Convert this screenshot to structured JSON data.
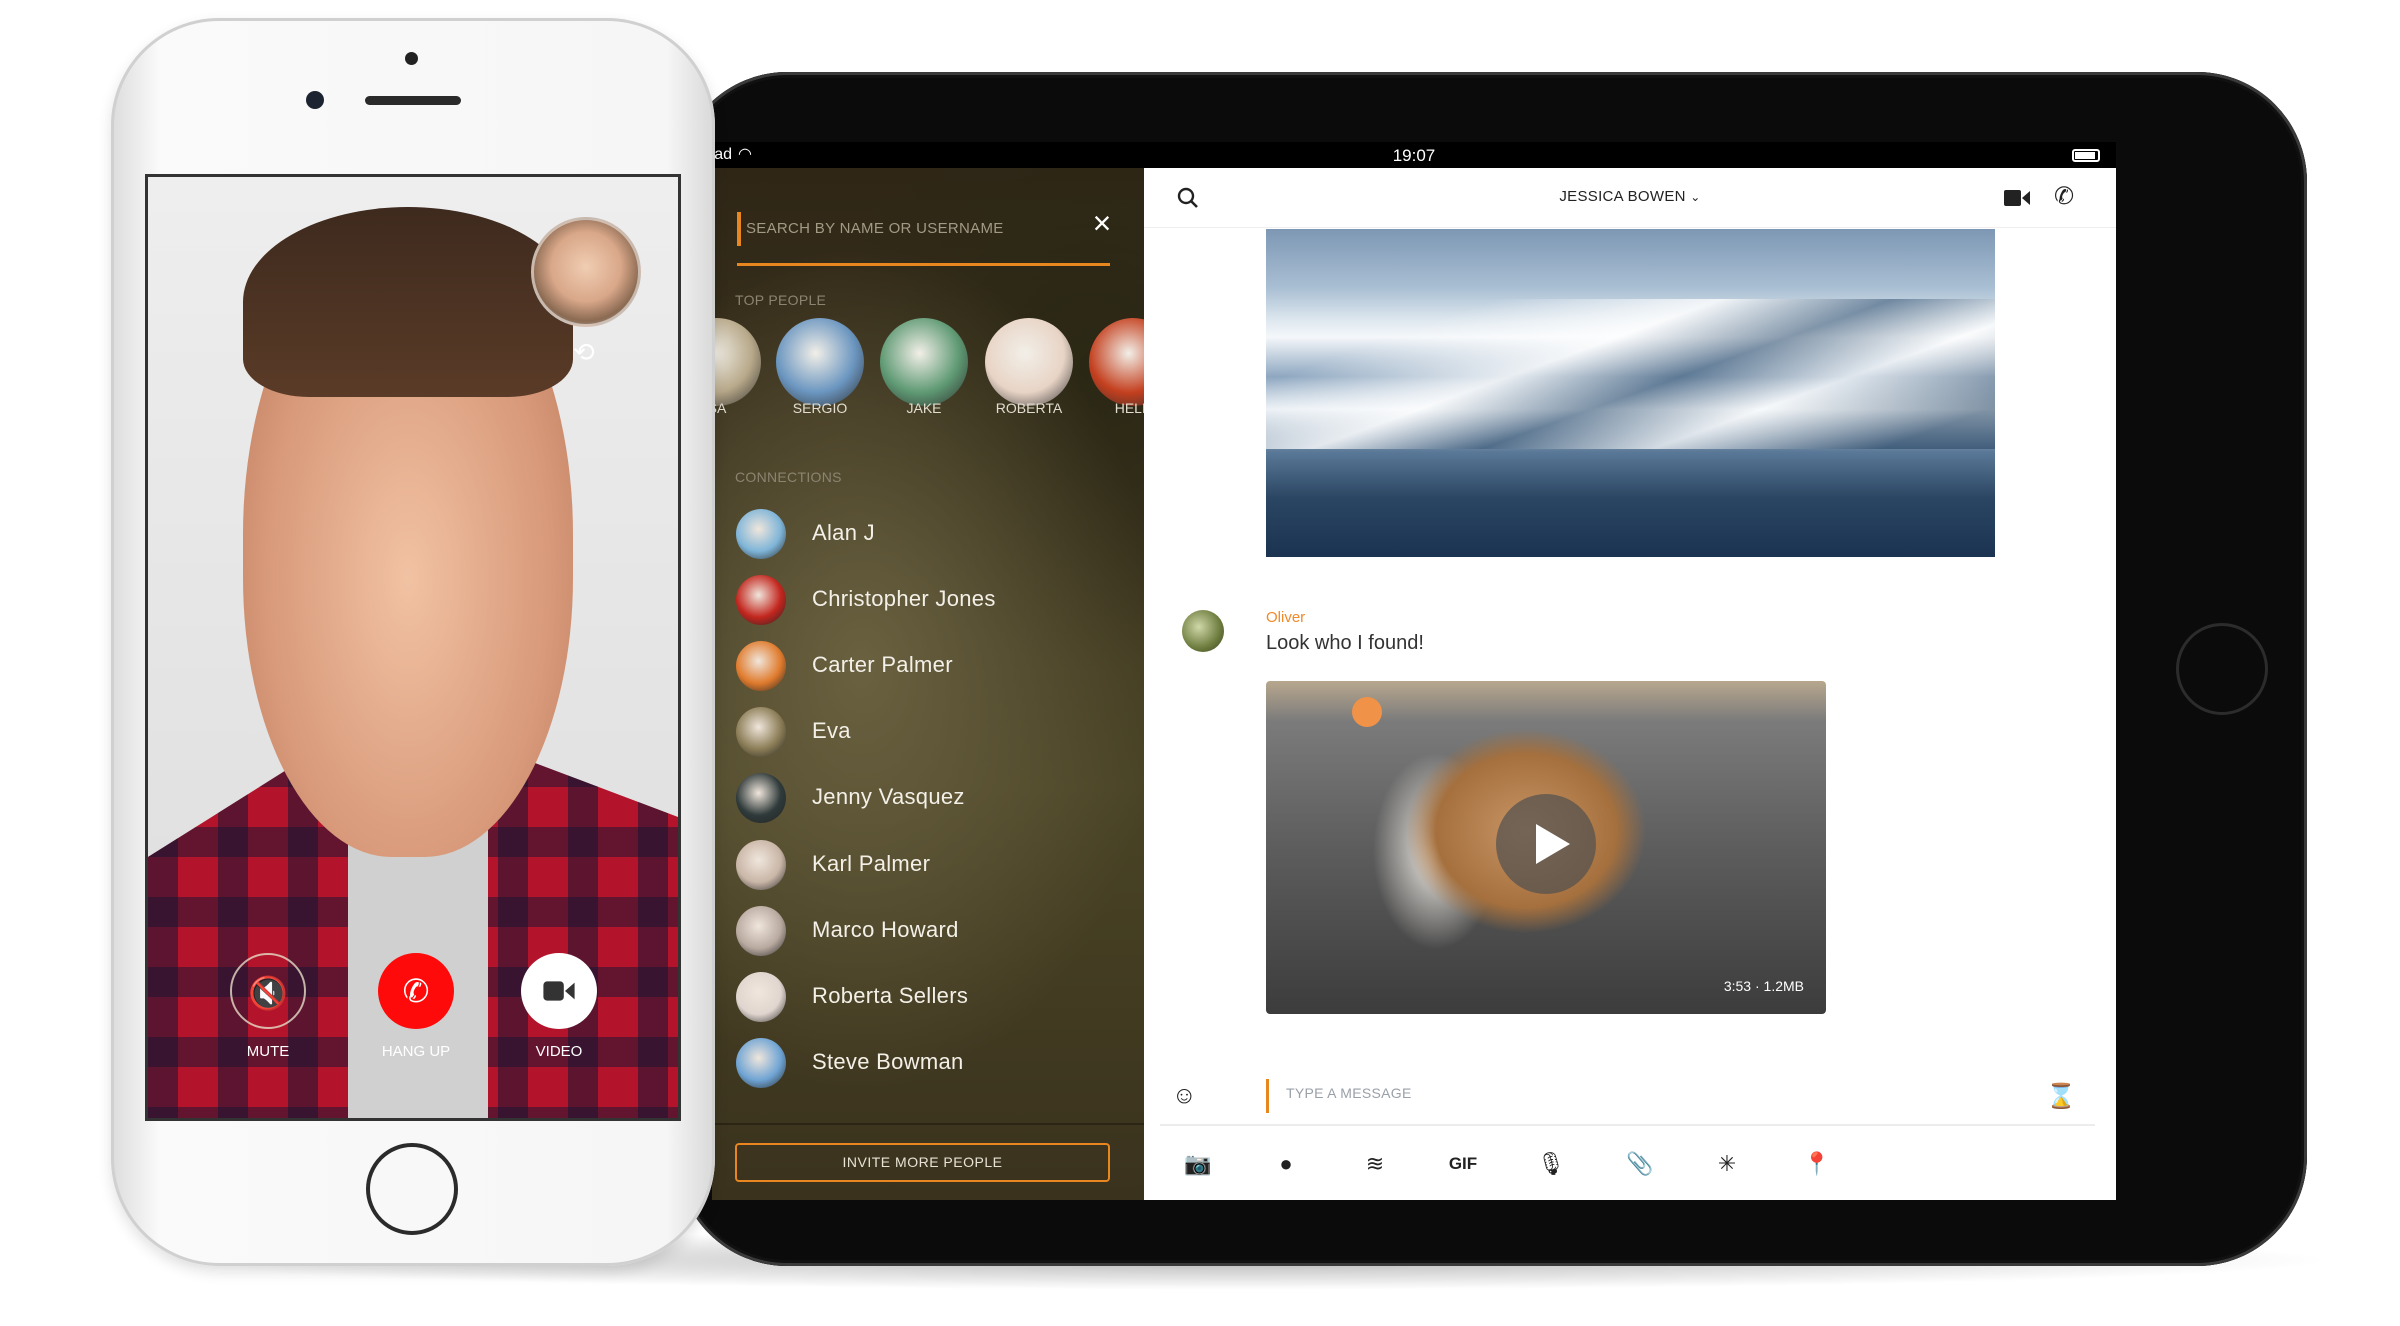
{
  "ipad": {
    "status": {
      "carrier": "iPad",
      "time": "19:07"
    },
    "sidebar": {
      "search_placeholder": "SEARCH BY NAME OR USERNAME",
      "top_people_label": "TOP PEOPLE",
      "top_people": [
        {
          "label": "SA",
          "color": "#b8a98a"
        },
        {
          "label": "SERGIO",
          "color": "#6b96c0"
        },
        {
          "label": "JAKE",
          "color": "#5f9a74"
        },
        {
          "label": "ROBERTA",
          "color": "#e8d4c6"
        },
        {
          "label": "HELE",
          "color": "#c4401f"
        }
      ],
      "connections_label": "CONNECTIONS",
      "connections": [
        {
          "name": "Alan J",
          "color": "#7fb5d8"
        },
        {
          "name": "Christopher Jones",
          "color": "#c2261e"
        },
        {
          "name": "Carter Palmer",
          "color": "#e07b2d"
        },
        {
          "name": "Eva",
          "color": "#8b7d56"
        },
        {
          "name": "Jenny Vasquez",
          "color": "#2f3a3a"
        },
        {
          "name": "Karl Palmer",
          "color": "#c9b6a7"
        },
        {
          "name": "Marco Howard",
          "color": "#b9aaa0"
        },
        {
          "name": "Roberta Sellers",
          "color": "#e1d6cf"
        },
        {
          "name": "Steve Bowman",
          "color": "#6fa4d4"
        }
      ],
      "invite_label": "INVITE MORE PEOPLE"
    },
    "chat": {
      "title": "JESSICA BOWEN",
      "message": {
        "sender": "Oliver",
        "text": "Look who I found!"
      },
      "video_meta": "3:53 · 1.2MB",
      "compose_placeholder": "TYPE A MESSAGE",
      "toolbar": [
        {
          "icon": "camera-icon",
          "glyph": "📷"
        },
        {
          "icon": "record-icon",
          "glyph": "●"
        },
        {
          "icon": "doodle-icon",
          "glyph": "≋"
        },
        {
          "icon": "gif-icon",
          "glyph": "GIF"
        },
        {
          "icon": "microphone-icon",
          "glyph": "🎙"
        },
        {
          "icon": "attachment-icon",
          "glyph": "📎"
        },
        {
          "icon": "sparkle-icon",
          "glyph": "✳"
        },
        {
          "icon": "location-icon",
          "glyph": "📍"
        }
      ]
    },
    "accent": "#e8861f"
  },
  "iphone": {
    "call_buttons": {
      "mute": "MUTE",
      "hang_up": "HANG UP",
      "video": "VIDEO"
    },
    "hang_up_color": "#ff0a0a"
  }
}
